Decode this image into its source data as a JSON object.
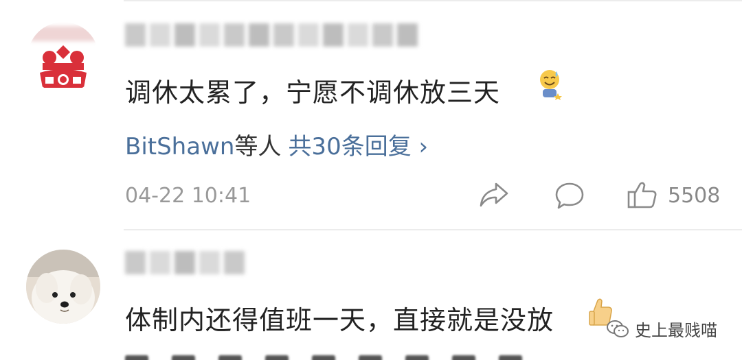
{
  "comments": [
    {
      "text": "调休太累了，宁愿不调休放三天",
      "replies_users": "BitShawn",
      "replies_suffix": "等人",
      "replies_count": "共30条回复 ›",
      "timestamp": "04-22 10:41",
      "like_count": "5508"
    },
    {
      "text": "体制内还得值班一天，直接就是没放"
    }
  ],
  "watermark": {
    "text": "史上最贱喵"
  },
  "colors": {
    "link": "#4a6f9a",
    "text": "#222222",
    "muted": "#999999",
    "divider": "#ececec",
    "avatar_red": "#d9303a"
  },
  "icons": [
    "share-icon",
    "comment-icon",
    "like-icon",
    "wechat-icon"
  ]
}
